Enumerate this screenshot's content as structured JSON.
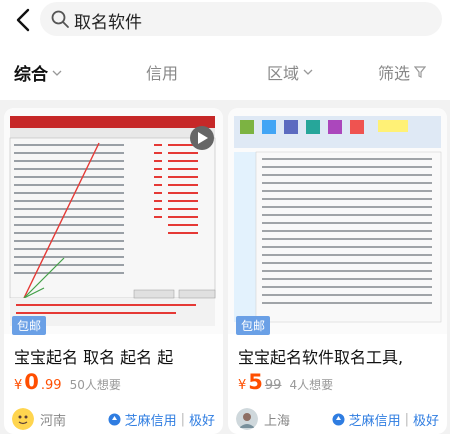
{
  "search": {
    "query": "取名软件"
  },
  "filters": [
    {
      "label": "综合"
    },
    {
      "label": "信用"
    },
    {
      "label": "区域"
    },
    {
      "label": "筛选"
    }
  ],
  "items": [
    {
      "tag": "包邮",
      "title": "宝宝起名 取名 起名 起",
      "price_yen": "¥",
      "price_int": "0",
      "price_dec": ".99",
      "want": "50人想要",
      "location": "河南",
      "credit": "芝麻信用",
      "level": "极好"
    },
    {
      "tag": "包邮",
      "title": "宝宝起名软件取名工具,",
      "price_yen": "¥",
      "price_int": "5",
      "price_dec": "99",
      "want": "4人想要",
      "location": "上海",
      "credit": "芝麻信用",
      "level": "极好"
    }
  ],
  "colors": {
    "price": "#ff4e00",
    "tag": "#6aa0e6",
    "credit": "#2f7de1"
  }
}
